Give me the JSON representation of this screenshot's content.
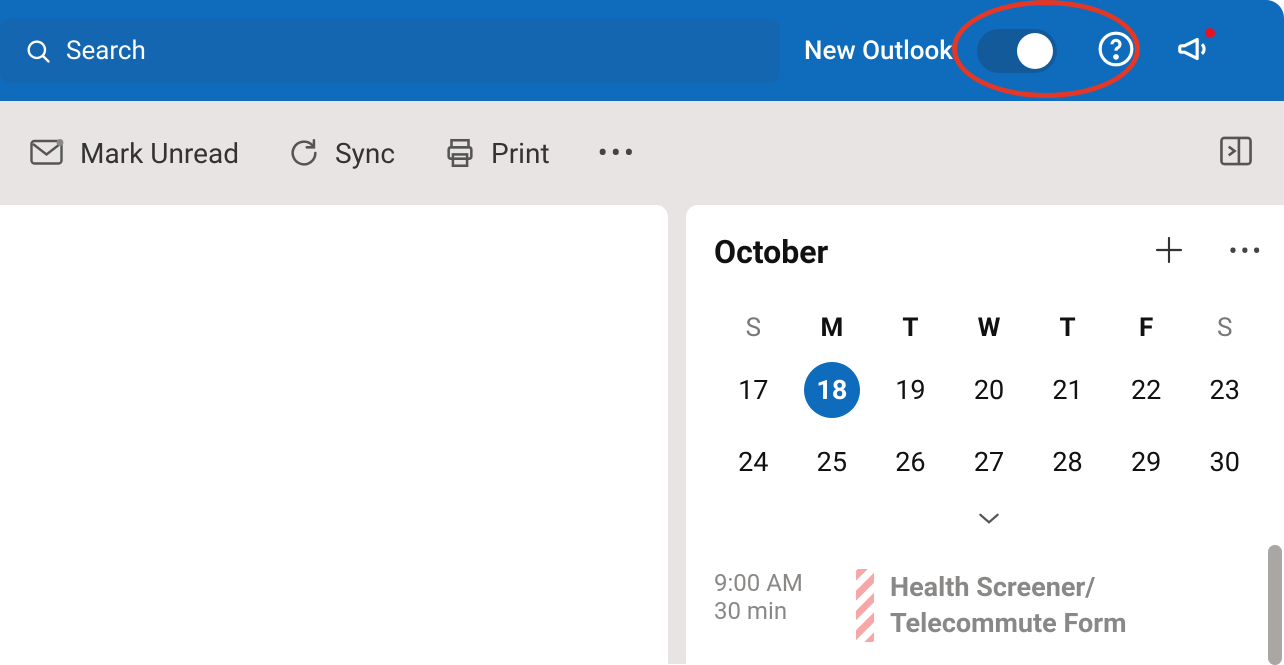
{
  "topbar": {
    "search_placeholder": "Search",
    "new_outlook_label": "New Outlook"
  },
  "toolbar": {
    "mark_unread_label": "Mark Unread",
    "sync_label": "Sync",
    "print_label": "Print"
  },
  "calendar": {
    "month_label": "October",
    "dow": [
      "S",
      "M",
      "T",
      "W",
      "T",
      "F",
      "S"
    ],
    "row1": [
      "17",
      "18",
      "19",
      "20",
      "21",
      "22",
      "23"
    ],
    "row2": [
      "24",
      "25",
      "26",
      "27",
      "28",
      "29",
      "30"
    ],
    "selected_day": "18"
  },
  "event": {
    "time": "9:00 AM",
    "duration": "30 min",
    "title_line1": "Health Screener/",
    "title_line2": "Telecommute Form"
  }
}
